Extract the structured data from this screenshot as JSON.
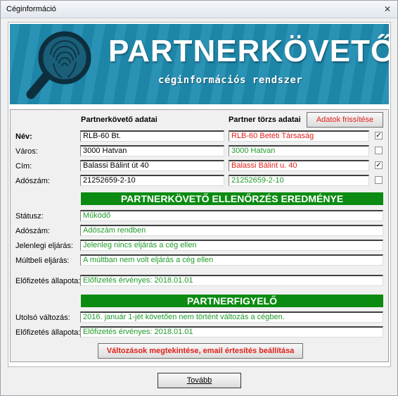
{
  "window": {
    "title": "Céginformáció"
  },
  "banner": {
    "brand": "PARTNERKÖVETŐ",
    "subtitle": "céginformációs rendszer"
  },
  "partner_table": {
    "col_left": "Partnerkövető adatai",
    "col_right": "Partner törzs adatai",
    "refresh_button": "Adatok frissítése",
    "rows": [
      {
        "label": "Név:",
        "left": "RLB-60 Bt.",
        "right": "RLB-60 Betéti Társaság",
        "checked": true
      },
      {
        "label": "Város:",
        "left": "3000 Hatvan",
        "right": "3000 Hatvan",
        "checked": false
      },
      {
        "label": "Cím:",
        "left": "Balassi Bálint út 40",
        "right": "Balassi Bálint u. 40",
        "checked": true
      },
      {
        "label": "Adószám:",
        "left": "21252659-2-10",
        "right": "21252659-2-10",
        "checked": false
      }
    ]
  },
  "check_section": {
    "title": "PARTNERKÖVETŐ ELLENŐRZÉS EREDMÉNYE",
    "rows": [
      {
        "label": "Státusz:",
        "value": "Működő"
      },
      {
        "label": "Adószám:",
        "value": "Adószám rendben"
      },
      {
        "label": "Jelenlegi eljárás:",
        "value": "Jelenleg nincs eljárás a cég ellen"
      },
      {
        "label": "Múltbeli eljárás:",
        "value": "A múltban nem volt eljárás a cég ellen"
      }
    ],
    "subscription_label": "Előfizetés állapota:",
    "subscription_value": "Előfizetés érvényes: 2018.01.01"
  },
  "monitor_section": {
    "title": "PARTNERFIGYELŐ",
    "last_change_label": "Utolsó változás:",
    "last_change_value": "2016. január 1-jét követően nem történt változás a cégben.",
    "subscription_label": "Előfizetés állapota:",
    "subscription_value": "Előfizetés érvényes: 2018.01.01",
    "changes_button": "Változások megtekintése, email értesítés beállítása"
  },
  "footer": {
    "next_button": "Tovább"
  },
  "colors": {
    "banner": "#1f8cb0",
    "green_bar": "#0b8b11",
    "red_text": "#e0201a",
    "green_text": "#1f9a2a"
  }
}
